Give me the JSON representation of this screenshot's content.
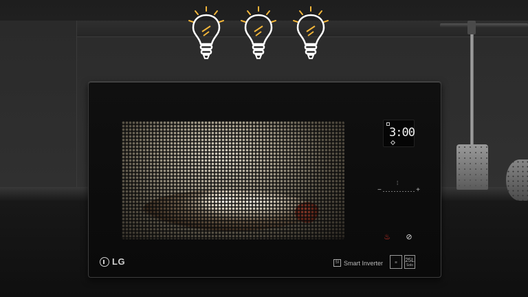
{
  "display": {
    "time": "3:00"
  },
  "brand": {
    "logo_text": "LG"
  },
  "badges": {
    "smart_inverter": "Smart Inverter",
    "smart_inverter_icon": "SI",
    "capacity_size": "25L",
    "capacity_unit": "Solo"
  },
  "bulbs": [
    {
      "icon": "lightbulb-icon",
      "state": "lit"
    },
    {
      "icon": "lightbulb-icon",
      "state": "lit"
    },
    {
      "icon": "lightbulb-icon",
      "state": "lit"
    }
  ],
  "colors": {
    "bulb_glow": "#f2b63a",
    "bulb_outline": "#ffffff",
    "quick_button": "#e0342a"
  }
}
